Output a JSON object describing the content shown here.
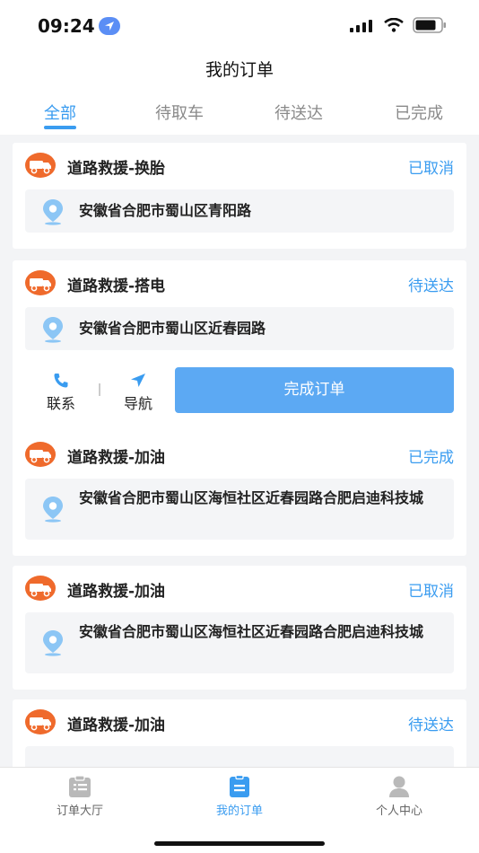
{
  "status_bar": {
    "time": "09:24"
  },
  "nav": {
    "title": "我的订单"
  },
  "tabs": [
    {
      "label": "全部",
      "active": true
    },
    {
      "label": "待取车",
      "active": false
    },
    {
      "label": "待送达",
      "active": false
    },
    {
      "label": "已完成",
      "active": false
    }
  ],
  "orders": [
    {
      "service": "道路救援-换胎",
      "status": "已取消",
      "address": "安徽省合肥市蜀山区青阳路"
    },
    {
      "service": "道路救援-搭电",
      "status": "待送达",
      "address": "安徽省合肥市蜀山区近春园路",
      "actions": {
        "contact": "联系",
        "navigate": "导航",
        "complete": "完成订单"
      }
    },
    {
      "service": "道路救援-加油",
      "status": "已完成",
      "address": "安徽省合肥市蜀山区海恒社区近春园路合肥启迪科技城"
    },
    {
      "service": "道路救援-加油",
      "status": "已取消",
      "address": "安徽省合肥市蜀山区海恒社区近春园路合肥启迪科技城"
    },
    {
      "service": "道路救援-加油",
      "status": "待送达",
      "address": ""
    }
  ],
  "tabbar": [
    {
      "label": "订单大厅",
      "icon": "clipboard-icon",
      "active": false
    },
    {
      "label": "我的订单",
      "icon": "document-icon",
      "active": true
    },
    {
      "label": "个人中心",
      "icon": "person-icon",
      "active": false
    }
  ],
  "colors": {
    "accent": "#3a9cf0",
    "button": "#5ca9f3",
    "service_icon": "#ef6a2c"
  }
}
